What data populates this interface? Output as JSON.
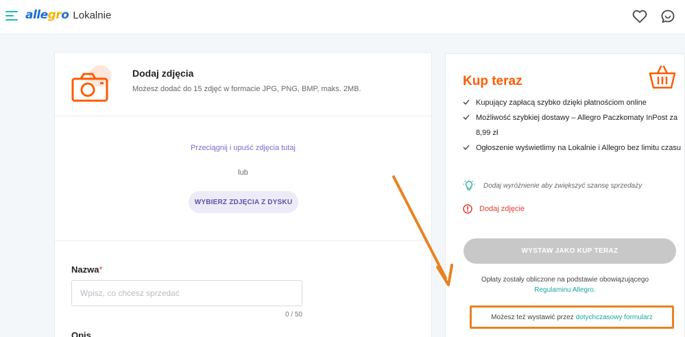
{
  "header": {
    "logo_allegro": "allegro",
    "logo_suffix": "Lokalnie",
    "icons": [
      "hamburger-menu-icon",
      "heart-icon",
      "chat-icon"
    ]
  },
  "photos": {
    "title": "Dodaj zdjęcia",
    "subtitle": "Możesz dodać do 15 zdjęć w formacie JPG, PNG, BMP, maks. 2MB.",
    "drop_text": "Przeciągnij i upuść zdjęcia tutaj",
    "or_text": "lub",
    "choose_button": "WYBIERZ ZDJĘCIA Z DYSKU"
  },
  "name_field": {
    "label": "Nazwa",
    "required_mark": "*",
    "placeholder": "Wpisz, co chcesz sprzedać",
    "value": "",
    "counter": "0 / 50"
  },
  "description": {
    "label": "Opis"
  },
  "buy_now": {
    "title": "Kup teraz",
    "features": [
      "Kupujący zapłacą szybko dzięki płatnościom online",
      "Możliwość szybkiej dostawy – Allegro Paczkomaty InPost za 8,99 zł",
      "Ogłoszenie wyświetlimy na Lokalnie i Allegro bez limitu czasu"
    ],
    "tip": "Dodaj wyróżnienie aby zwiększyć szansę sprzedaży",
    "warning": "Dodaj zdjęcie",
    "submit_button": "WYSTAW JAKO KUP TERAZ",
    "fees_text": "Opłaty zostały obliczone na podstawie obowiązującego",
    "fees_link": "Regulaminu Allegro.",
    "legacy_text": "Możesz też wystawić przez",
    "legacy_link": "dotychczasowy formularz"
  },
  "colors": {
    "brand_orange": "#ff5a00",
    "teal": "#1cb9a7",
    "purple": "#5e51a9",
    "error": "#e63b2e",
    "annotation": "#e8821f"
  }
}
